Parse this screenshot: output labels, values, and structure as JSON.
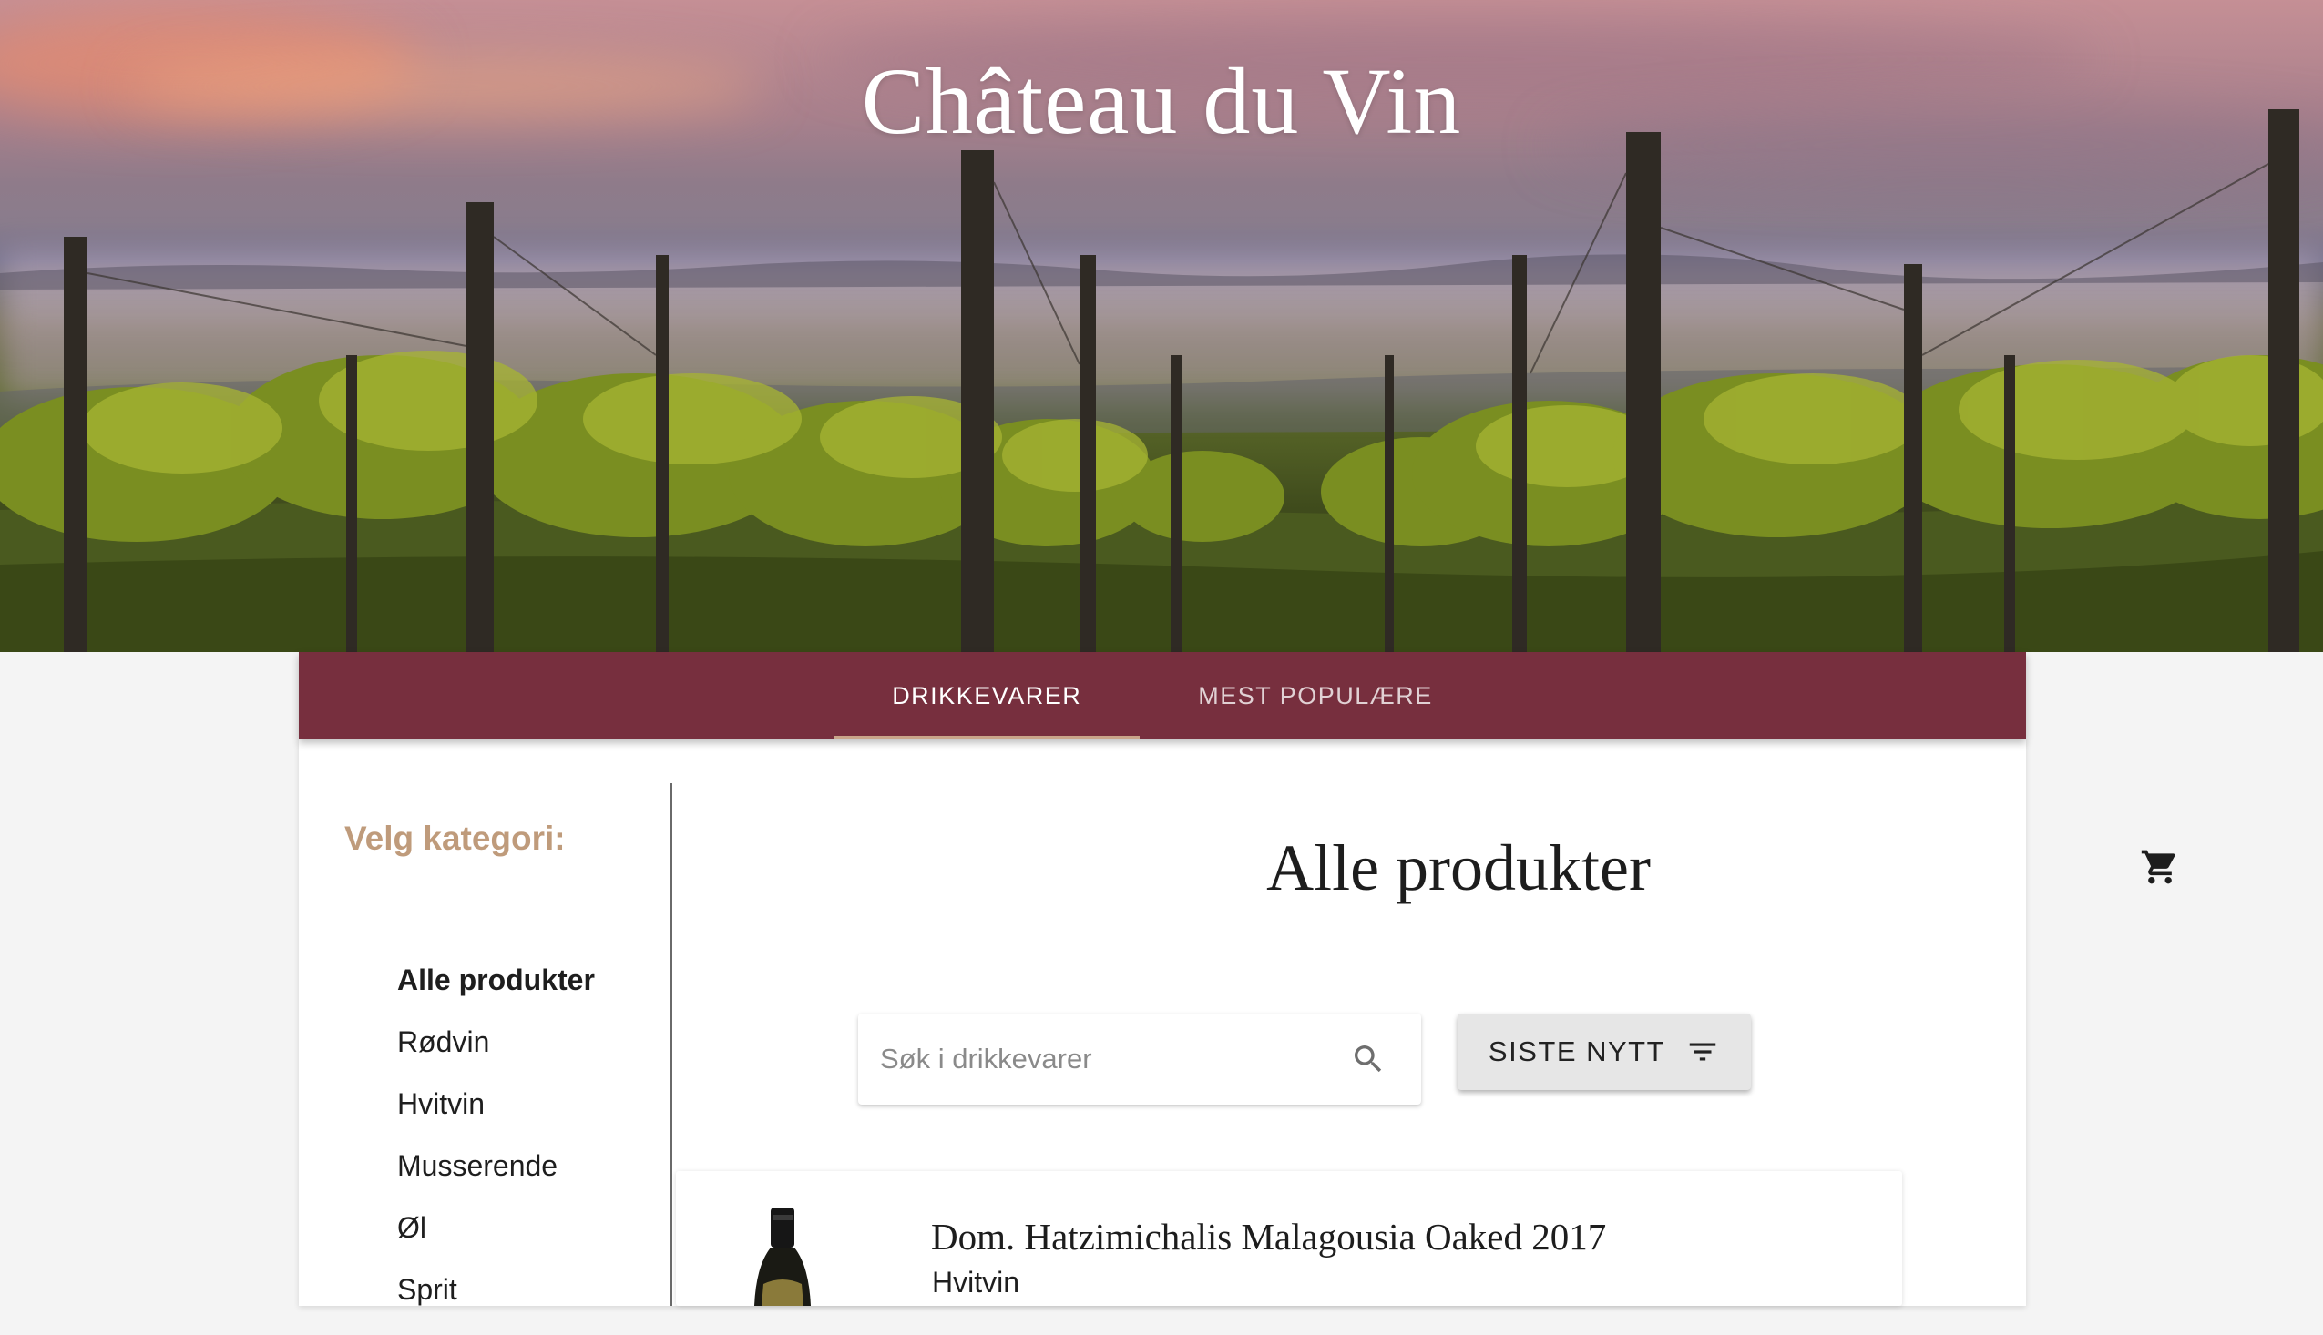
{
  "hero": {
    "title": "Château du Vin"
  },
  "nav": {
    "tabs": [
      {
        "label": "DRIKKEVARER",
        "active": true
      },
      {
        "label": "MEST POPULÆRE",
        "active": false
      }
    ],
    "colors": {
      "bar": "#772f3e",
      "indicator": "#caa58a"
    }
  },
  "sidebar": {
    "title": "Velg kategori:",
    "categories": [
      {
        "label": "Alle produkter",
        "active": true
      },
      {
        "label": "Rødvin",
        "active": false
      },
      {
        "label": "Hvitvin",
        "active": false
      },
      {
        "label": "Musserende",
        "active": false
      },
      {
        "label": "Øl",
        "active": false
      },
      {
        "label": "Sprit",
        "active": false
      }
    ]
  },
  "main": {
    "title": "Alle produkter",
    "cart_icon": "shopping-cart-icon",
    "search": {
      "placeholder": "Søk i drikkevarer",
      "value": "",
      "icon": "search-icon"
    },
    "filter": {
      "label": "SISTE NYTT",
      "icon": "filter-list-icon"
    },
    "products": [
      {
        "name": "Dom. Hatzimichalis Malagousia Oaked 2017",
        "type": "Hvitvin"
      }
    ]
  }
}
